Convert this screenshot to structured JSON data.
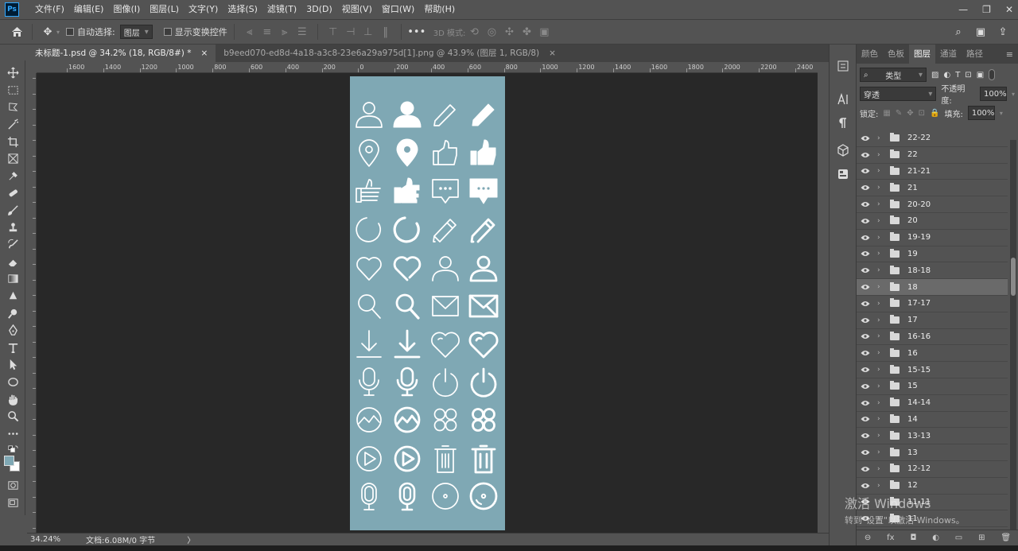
{
  "app": {
    "logo": "Ps"
  },
  "menu": [
    "文件(F)",
    "编辑(E)",
    "图像(I)",
    "图层(L)",
    "文字(Y)",
    "选择(S)",
    "滤镜(T)",
    "3D(D)",
    "视图(V)",
    "窗口(W)",
    "帮助(H)"
  ],
  "options": {
    "auto_select_label": "自动选择:",
    "auto_select_value": "图层",
    "transform_label": "显示变换控件",
    "mode_label": "3D 模式:"
  },
  "tabs": [
    {
      "label": "未标题-1.psd @ 34.2% (18, RGB/8#) *",
      "close": "×"
    },
    {
      "label": "b9eed070-ed8d-4a18-a3c8-23e6a29a975d[1].png @ 43.9% (图层 1, RGB/8)",
      "close": "×"
    }
  ],
  "ruler": {
    "top_labels": [
      "1600",
      "1400",
      "1200",
      "1000",
      "800",
      "600",
      "400",
      "200",
      "0",
      "200",
      "400",
      "600",
      "800",
      "1000",
      "1200",
      "1400",
      "1600",
      "1800",
      "2000",
      "2200",
      "2400"
    ]
  },
  "status": {
    "zoom": "34.24%",
    "doc_info": "文档:6.08M/0 字节",
    "arrow": "〉"
  },
  "panel": {
    "tabs": [
      "颜色",
      "色板",
      "图层",
      "通道",
      "路径"
    ],
    "active_tab": "图层",
    "filter_value": "类型",
    "blend_mode": "穿透",
    "opacity_label": "不透明度:",
    "opacity_value": "100%",
    "lock_label": "锁定:",
    "fill_label": "填充:",
    "fill_value": "100%",
    "layers": [
      "22-22",
      "22",
      "21-21",
      "21",
      "20-20",
      "20",
      "19-19",
      "19",
      "18-18",
      "18",
      "17-17",
      "17",
      "16-16",
      "16",
      "15-15",
      "15",
      "14-14",
      "14",
      "13-13",
      "13",
      "12-12",
      "12",
      "11-11",
      "11"
    ],
    "selected_layer": "18",
    "footer": [
      "⊖",
      "fx",
      "◘",
      "◐",
      "▭",
      "⊞",
      "🗑"
    ]
  },
  "watermark": {
    "line1": "激活 Windows",
    "line2": "转到\"设置\"以激活 Windows。"
  },
  "colors": {
    "accent": "#31a8ff",
    "artboard": "#7fa8b4",
    "canvas_bg": "#282828",
    "ui_bg": "#535353"
  },
  "icons": [
    "user-outline-icon",
    "user-filled-icon",
    "pencil-outline-icon",
    "pencil-filled-icon",
    "location-outline-icon",
    "location-filled-icon",
    "thumbs-up-outline-icon",
    "thumbs-up-filled-icon",
    "pointing-hand-outline-icon",
    "pointing-hand-filled-icon",
    "chat-outline-icon",
    "chat-filled-icon",
    "loading-ring-icon",
    "loading-ring-bold-icon",
    "edit-pencil-icon",
    "edit-pencil-bold-icon",
    "heart-outline-icon",
    "heart-bold-icon",
    "person-outline-icon",
    "person-bold-icon",
    "search-outline-icon",
    "search-bold-icon",
    "mail-outline-icon",
    "mail-bold-icon",
    "download-outline-icon",
    "download-bold-icon",
    "heart-curve-icon",
    "heart-curve-bold-icon",
    "microphone-outline-icon",
    "microphone-bold-icon",
    "power-outline-icon",
    "power-bold-icon",
    "chart-circle-icon",
    "chart-circle-bold-icon",
    "apps-outline-icon",
    "apps-bold-icon",
    "play-circle-icon",
    "play-circle-bold-icon",
    "trash-outline-icon",
    "trash-bold-icon",
    "mic-capsule-icon",
    "mic-capsule-bold-icon",
    "disc-outline-icon",
    "disc-bold-icon"
  ]
}
